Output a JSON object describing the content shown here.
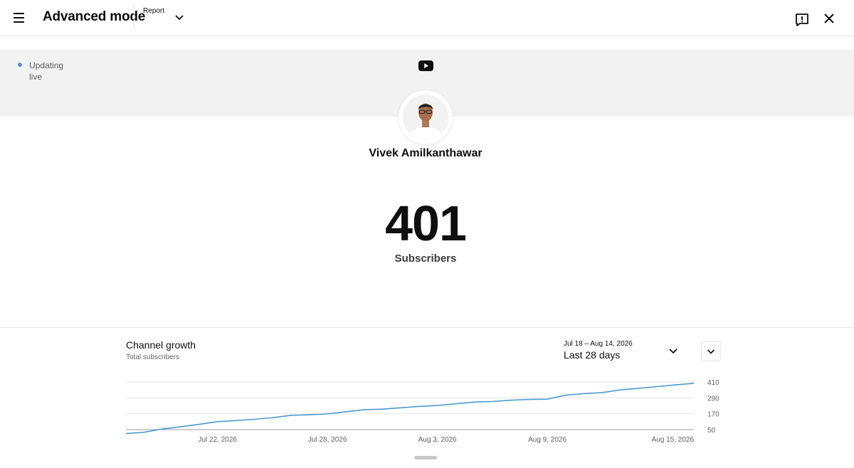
{
  "header": {
    "title": "Advanced mode",
    "report_label": "Report"
  },
  "status": {
    "live_text": "Updating live",
    "live_color": "#4a90e2"
  },
  "channel": {
    "name": "Vivek Amilkanthawar",
    "subscriber_count": "401",
    "subscriber_label": "Subscribers"
  },
  "growth": {
    "title": "Channel growth",
    "subtitle": "Total subscribers",
    "date_range": "Jul 18 – Aug 14, 2026",
    "range_label": "Last 28 days"
  },
  "icons": {
    "menu": "hamburger-menu-icon",
    "report_dropdown": "chevron-down-icon",
    "feedback": "feedback-icon",
    "close": "close-icon",
    "brand": "youtube-logo-icon",
    "range_dropdown": "chevron-down-icon",
    "collapse": "chevron-down-icon"
  },
  "colors": {
    "line": "#4a9cd1",
    "grid": "#e5e5e5",
    "banner": "#f2f2f2"
  },
  "chart_data": {
    "type": "line",
    "title": "Channel growth",
    "subtitle": "Total subscribers",
    "x_tick_labels": [
      "Jul 22, 2026",
      "Jul 28, 2026",
      "Aug 3, 2026",
      "Aug 9, 2026",
      "Aug 15, 2026"
    ],
    "x_tick_index": [
      5,
      11,
      17,
      23,
      29
    ],
    "y_ticks": [
      50,
      170,
      290,
      410
    ],
    "ylim": [
      50,
      410
    ],
    "series": [
      {
        "values": [
          20,
          30,
          55,
          72,
          90,
          110,
          118,
          128,
          140,
          158,
          162,
          168,
          185,
          200,
          205,
          215,
          225,
          232,
          245,
          258,
          262,
          272,
          278,
          280,
          310,
          322,
          330,
          350,
          362,
          375,
          388,
          400
        ]
      }
    ],
    "grid": true,
    "y_axis_side": "right"
  }
}
